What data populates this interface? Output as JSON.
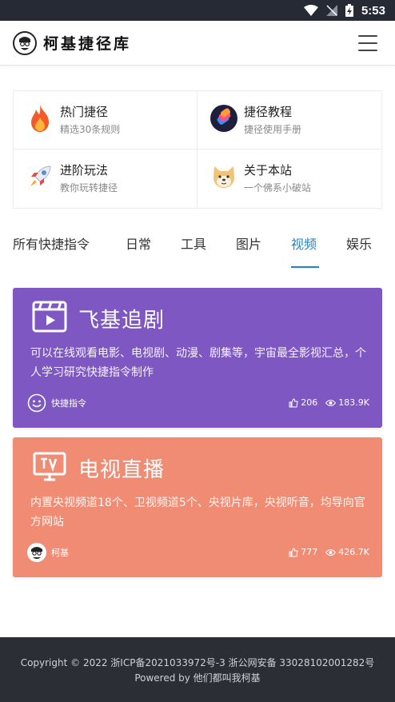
{
  "status_bar": {
    "time": "5:53"
  },
  "header": {
    "site_title": "柯基捷径库"
  },
  "quick_links": [
    {
      "title": "热门捷径",
      "subtitle": "精选30条规则",
      "icon": "flame-icon"
    },
    {
      "title": "捷径教程",
      "subtitle": "捷径使用手册",
      "icon": "shortcuts-app-icon"
    },
    {
      "title": "进阶玩法",
      "subtitle": "教你玩转捷径",
      "icon": "rocket-icon"
    },
    {
      "title": "关于本站",
      "subtitle": "一个佛系小破站",
      "icon": "shiba-dog-icon"
    }
  ],
  "tabs": {
    "items": [
      "所有快捷指令",
      "日常",
      "工具",
      "图片",
      "视频",
      "娱乐"
    ],
    "active": "视频"
  },
  "cards": [
    {
      "title": "飞基追剧",
      "description": "可以在线观看电影、电视剧、动漫、剧集等，宇宙最全影视汇总，个人学习研究快捷指令制作",
      "author": "快捷指令",
      "likes": "206",
      "views": "183.9K",
      "color": "#7e57c2",
      "icon": "video-player-icon"
    },
    {
      "title": "电视直播",
      "description": "内置央视频道18个、卫视频道5个、央视片库，央视听音，均导向官方网站",
      "author": "柯基",
      "likes": "777",
      "views": "426.7K",
      "color": "#f08c74",
      "icon": "tv-icon"
    }
  ],
  "footer": {
    "copyright": "Copyright © 2022 浙ICP备2021033972号-3 浙公网安备 33028102001282号",
    "powered": "Powered by 他们都叫我柯基"
  },
  "colors": {
    "accent": "#1d88c9",
    "status_bar": "#262a35",
    "footer": "#2b2e35"
  }
}
